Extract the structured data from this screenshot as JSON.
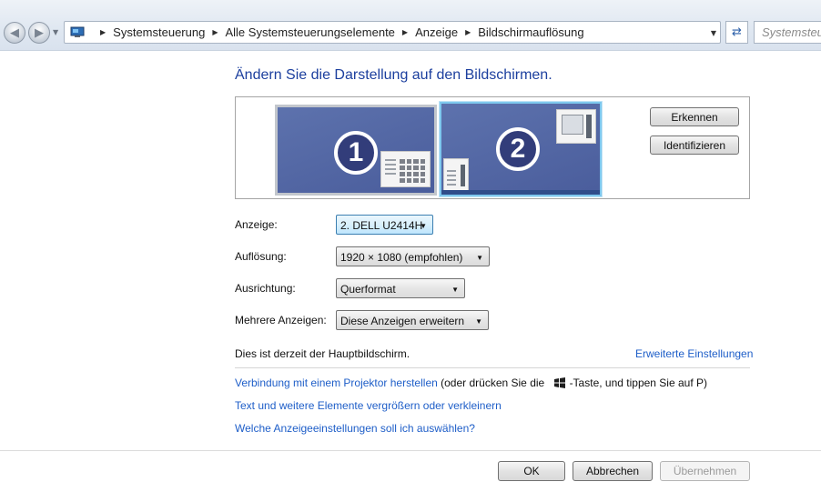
{
  "toolbar": {
    "breadcrumbs": [
      "Systemsteuerung",
      "Alle Systemsteuerungselemente",
      "Anzeige",
      "Bildschirmauflösung"
    ],
    "search_placeholder": "Systemsteuerung durchsuchen"
  },
  "main": {
    "title": "Ändern Sie die Darstellung auf den Bildschirmen.",
    "monitors": [
      {
        "number": "1",
        "selected": false
      },
      {
        "number": "2",
        "selected": true
      }
    ],
    "detect_label": "Erkennen",
    "identify_label": "Identifizieren",
    "fields": {
      "display": {
        "label": "Anzeige:",
        "value": "2. DELL U2414H"
      },
      "resolution": {
        "label": "Auflösung:",
        "value": "1920 × 1080 (empfohlen)"
      },
      "orientation": {
        "label": "Ausrichtung:",
        "value": "Querformat"
      },
      "multiple": {
        "label": "Mehrere Anzeigen:",
        "value": "Diese Anzeigen erweitern"
      }
    },
    "main_display_text": "Dies ist derzeit der Hauptbildschirm.",
    "advanced_link": "Erweiterte Einstellungen",
    "projector_link": "Verbindung mit einem Projektor herstellen",
    "projector_hint_before": "(oder drücken Sie die",
    "projector_hint_after": "-Taste, und tippen Sie auf P)",
    "size_link": "Text und weitere Elemente vergrößern oder verkleinern",
    "help_link": "Welche Anzeigeeinstellungen soll ich auswählen?"
  },
  "footer": {
    "ok_label": "OK",
    "cancel_label": "Abbrechen",
    "apply_label": "Übernehmen"
  },
  "colors": {
    "title_blue": "#1c3f9e",
    "link_blue": "#1e5ec8",
    "monitor_fill": "#4a5d9c",
    "selected_border": "#7ec8ee"
  }
}
